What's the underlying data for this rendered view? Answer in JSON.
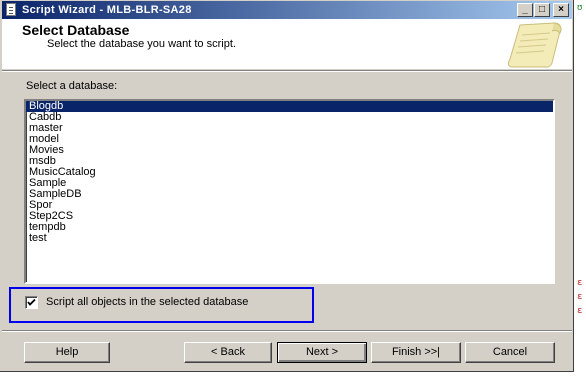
{
  "window": {
    "title": "Script Wizard - MLB-BLR-SA28",
    "minimize_glyph": "_",
    "maximize_glyph": "□",
    "close_glyph": "×"
  },
  "header": {
    "title": "Select Database",
    "subtitle": "Select the database you want to script."
  },
  "main": {
    "list_label": "Select a database:",
    "databases": [
      "Blogdb",
      "Cabdb",
      "master",
      "model",
      "Movies",
      "msdb",
      "MusicCatalog",
      "Sample",
      "SampleDB",
      "Spor",
      "Step2CS",
      "tempdb",
      "test"
    ],
    "selected_index": 0,
    "script_all_checkbox": {
      "label": "Script all objects in the selected database",
      "checked": true
    }
  },
  "footer": {
    "help": "Help",
    "back": "< Back",
    "next": "Next >",
    "finish": "Finish >>|",
    "cancel": "Cancel"
  },
  "colors": {
    "title_gradient_start": "#0a246a",
    "title_gradient_end": "#a6caf0",
    "selection": "#0a246a",
    "highlight_border": "#0000ee",
    "dialog_face": "#d4d0c8"
  }
}
